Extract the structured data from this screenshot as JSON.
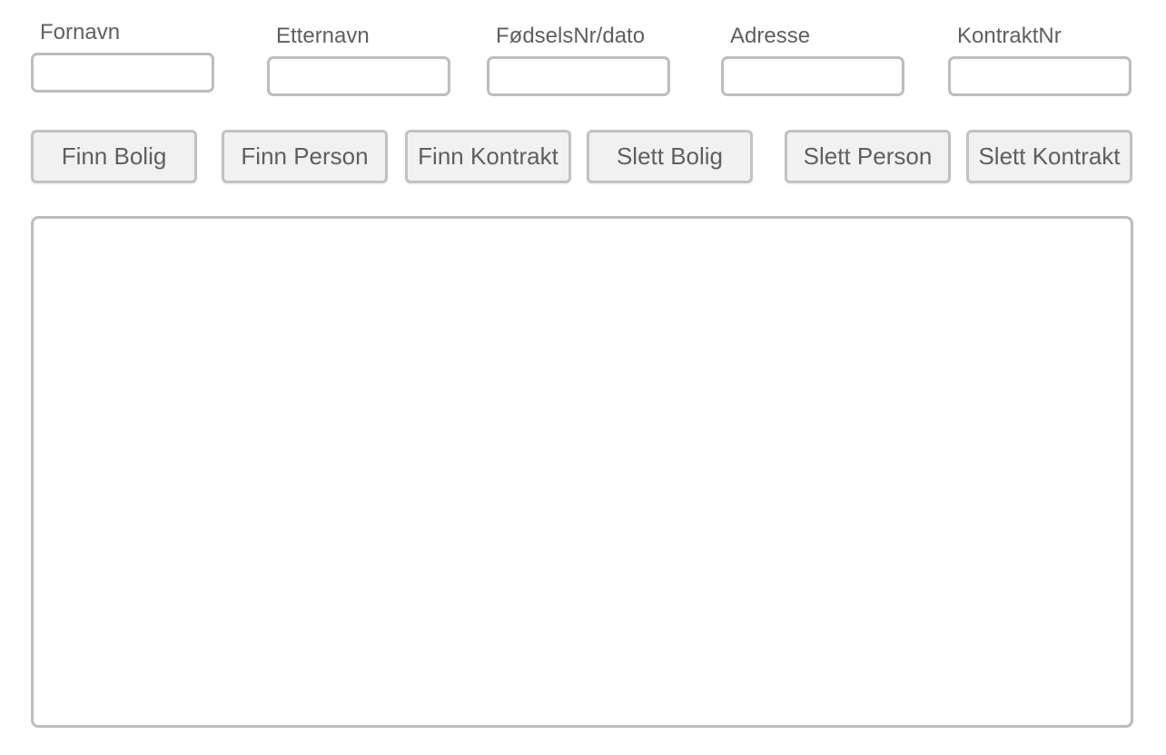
{
  "form": {
    "fields": [
      {
        "label": "Fornavn",
        "value": "",
        "placeholder": ""
      },
      {
        "label": "Etternavn",
        "value": "",
        "placeholder": ""
      },
      {
        "label": "FødselsNr/dato",
        "value": "",
        "placeholder": ""
      },
      {
        "label": "Adresse",
        "value": "",
        "placeholder": ""
      },
      {
        "label": "KontraktNr",
        "value": "",
        "placeholder": ""
      }
    ]
  },
  "actions": {
    "buttons": [
      {
        "label": "Finn Bolig"
      },
      {
        "label": "Finn Person"
      },
      {
        "label": "Finn Kontrakt"
      },
      {
        "label": "Slett Bolig"
      },
      {
        "label": "Slett Person"
      },
      {
        "label": "Slett Kontrakt"
      }
    ]
  },
  "output": {
    "value": ""
  },
  "colors": {
    "text": "#5f5f5f",
    "border": "#bdbdbd",
    "button_bg": "#f1f1f1"
  }
}
